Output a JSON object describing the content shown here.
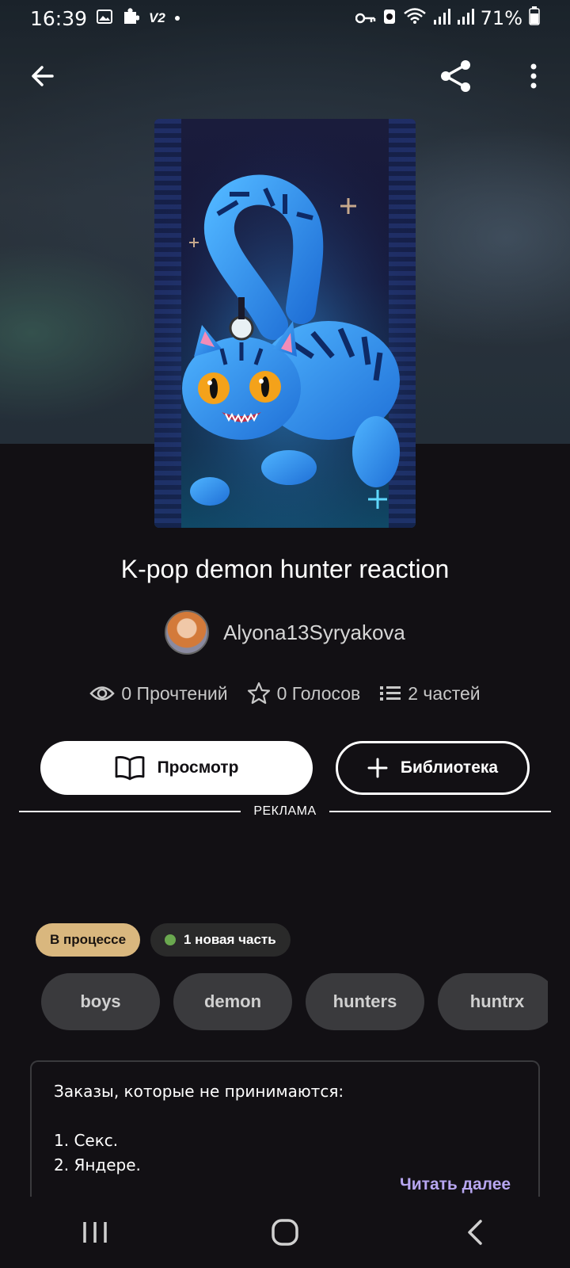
{
  "status_bar": {
    "time": "16:39",
    "badge": "V2",
    "battery": "71%"
  },
  "book": {
    "title": "K-pop demon hunter reaction",
    "author": "Alyona13Syryakova",
    "stats": {
      "reads": "0 Прочтений",
      "votes": "0 Голосов",
      "parts": "2 частей"
    }
  },
  "actions": {
    "view_label": "Просмотр",
    "library_label": "Библиотека"
  },
  "ad": {
    "label": "РЕКЛАМА"
  },
  "status": {
    "state": "В процессе",
    "new_parts": "1 новая часть"
  },
  "tags": [
    "boys",
    "demon",
    "hunters",
    "huntrx"
  ],
  "description": {
    "line1": "Заказы, которые не принимаются:",
    "line2": "1. Секс.",
    "line3": "2. Яндере.",
    "read_more": "Читать далее"
  },
  "colors": {
    "background": "#121014",
    "status_pill": "#d9b77e",
    "new_dot": "#6aa84f",
    "read_more": "#b7a6f0"
  }
}
